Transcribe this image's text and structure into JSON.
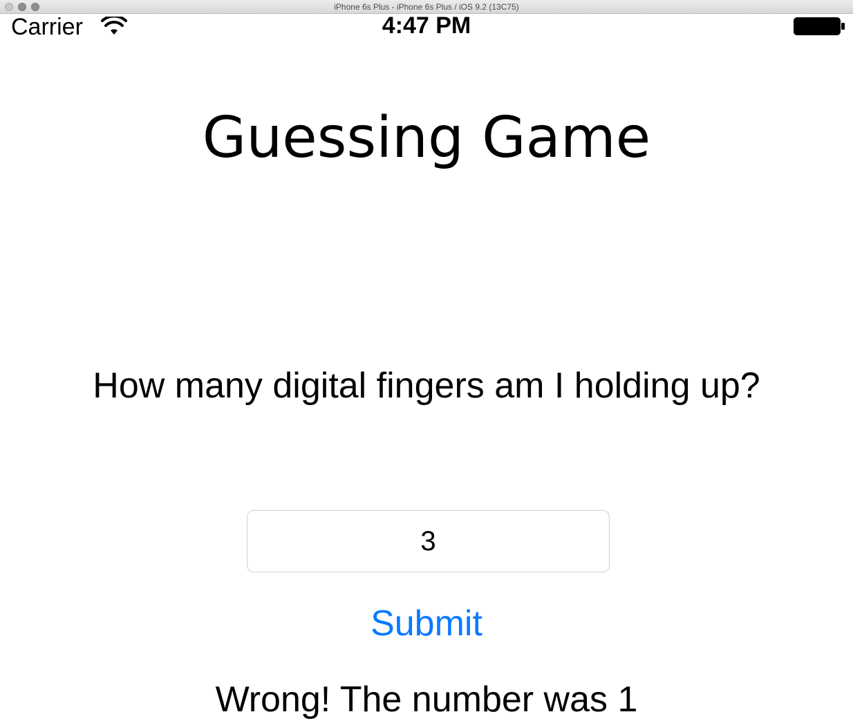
{
  "window": {
    "title": "iPhone 6s Plus - iPhone 6s Plus / iOS 9.2 (13C75)"
  },
  "status_bar": {
    "carrier": "Carrier",
    "time": "4:47 PM",
    "wifi_icon": "wifi-icon",
    "battery_icon": "battery-icon"
  },
  "game": {
    "title": "Guessing Game",
    "question": "How many digital fingers am I holding up?",
    "guess_value": "3",
    "submit_label": "Submit",
    "result_text": "Wrong! The number was 1"
  },
  "colors": {
    "accent": "#0a7aff",
    "text": "#000000",
    "background": "#ffffff"
  }
}
